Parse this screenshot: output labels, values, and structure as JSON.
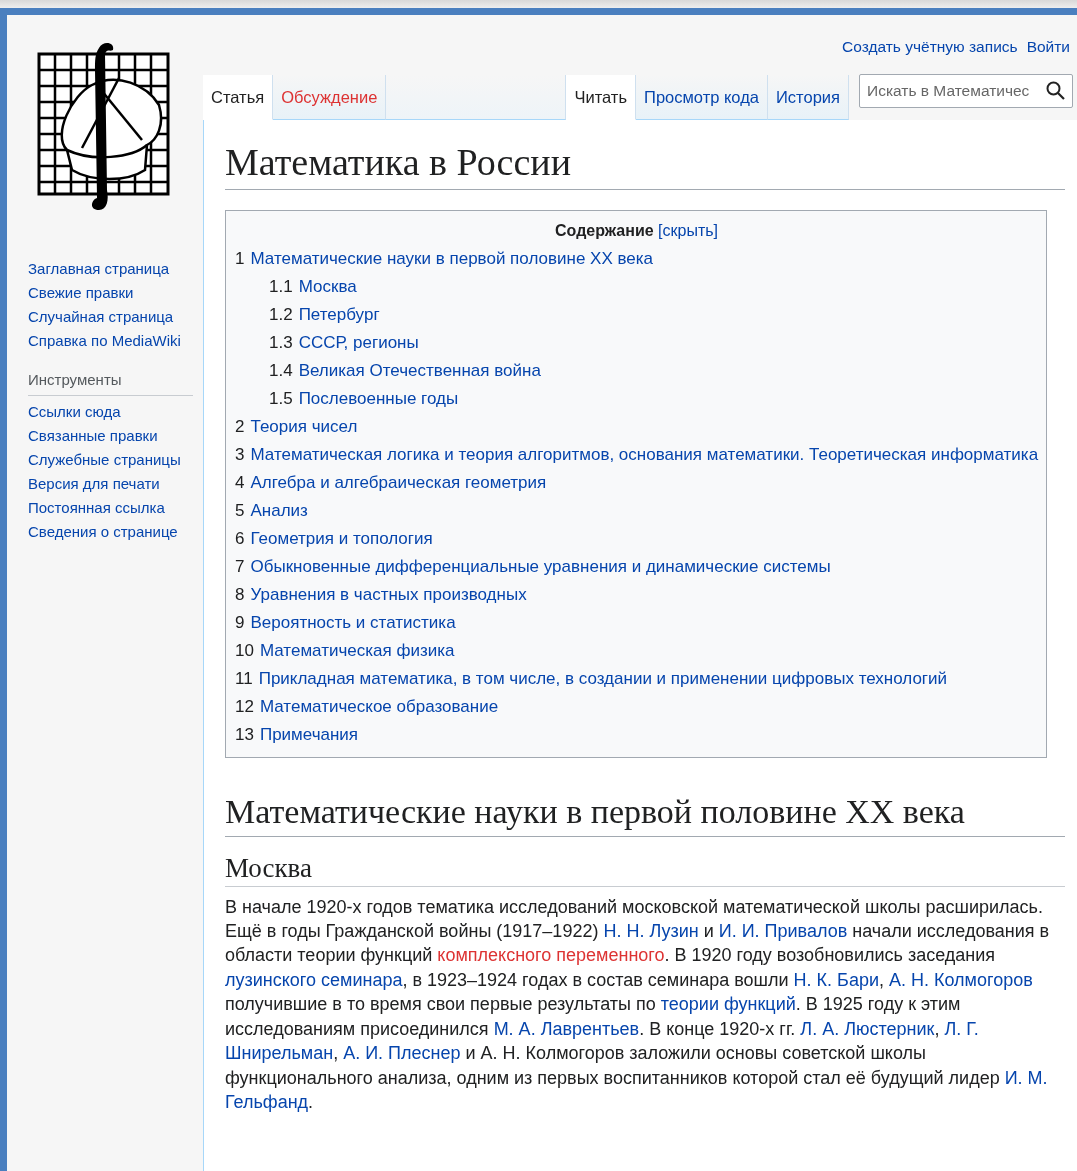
{
  "personal_links": [
    "Создать учётную запись",
    "Войти"
  ],
  "sidebar": {
    "navigation": [
      "Заглавная страница",
      "Свежие правки",
      "Случайная страница",
      "Справка по MediaWiki"
    ],
    "tools_heading": "Инструменты",
    "tools": [
      "Ссылки сюда",
      "Связанные правки",
      "Служебные страницы",
      "Версия для печати",
      "Постоянная ссылка",
      "Сведения о странице"
    ]
  },
  "tabs_left": [
    {
      "label": "Статья",
      "selected": true,
      "exists": true
    },
    {
      "label": "Обсуждение",
      "selected": false,
      "exists": false
    }
  ],
  "tabs_right": [
    {
      "label": "Читать",
      "selected": true
    },
    {
      "label": "Просмотр кода",
      "selected": false
    },
    {
      "label": "История",
      "selected": false
    }
  ],
  "search": {
    "placeholder": "Искать в Математичес"
  },
  "title": "Математика в России",
  "toc": {
    "title": "Содержание",
    "toggle": "[скрыть]",
    "items": [
      {
        "number": "1",
        "text": "Математические науки в первой половине XX века",
        "children": [
          {
            "number": "1.1",
            "text": "Москва"
          },
          {
            "number": "1.2",
            "text": "Петербург"
          },
          {
            "number": "1.3",
            "text": "СССР, регионы"
          },
          {
            "number": "1.4",
            "text": "Великая Отечественная война"
          },
          {
            "number": "1.5",
            "text": "Послевоенные годы"
          }
        ]
      },
      {
        "number": "2",
        "text": "Теория чисел"
      },
      {
        "number": "3",
        "text": "Математическая логика и теория алгоритмов, основания математики. Теоретическая информатика"
      },
      {
        "number": "4",
        "text": "Алгебра и алгебраическая геометрия"
      },
      {
        "number": "5",
        "text": "Анализ"
      },
      {
        "number": "6",
        "text": "Геометрия и топология"
      },
      {
        "number": "7",
        "text": "Обыкновенные дифференциальные уравнения и динамические системы"
      },
      {
        "number": "8",
        "text": "Уравнения в частных производных"
      },
      {
        "number": "9",
        "text": "Вероятность и статистика"
      },
      {
        "number": "10",
        "text": "Математическая физика"
      },
      {
        "number": "11",
        "text": "Прикладная математика, в том числе, в создании и применении цифровых технологий"
      },
      {
        "number": "12",
        "text": "Математическое образование"
      },
      {
        "number": "13",
        "text": "Примечания"
      }
    ]
  },
  "sections": [
    {
      "kind": "h2",
      "heading": "Математические науки в первой половине XX века"
    },
    {
      "kind": "h3",
      "heading": "Москва",
      "paragraph": [
        {
          "kind": "text",
          "text": "В начале 1920-х годов тематика исследований московской математической школы расширилась. Ещё в годы Гражданской войны (1917–1922) "
        },
        {
          "kind": "link",
          "text": "Н. Н. Лузин"
        },
        {
          "kind": "text",
          "text": " и "
        },
        {
          "kind": "link",
          "text": "И. И. Привалов"
        },
        {
          "kind": "text",
          "text": " начали исследования в области теории функций "
        },
        {
          "kind": "new_link",
          "text": "комплексного переменного"
        },
        {
          "kind": "text",
          "text": ". В 1920 году возобновились заседания "
        },
        {
          "kind": "link",
          "text": "лузинского семинара"
        },
        {
          "kind": "text",
          "text": ", в 1923–1924 годах в состав семинара вошли "
        },
        {
          "kind": "link",
          "text": "Н. К. Бари"
        },
        {
          "kind": "text",
          "text": ", "
        },
        {
          "kind": "link",
          "text": "А. Н. Колмогоров"
        },
        {
          "kind": "text",
          "text": " получившие в то время свои первые результаты по "
        },
        {
          "kind": "link",
          "text": "теории функций"
        },
        {
          "kind": "text",
          "text": ". В 1925 году к этим исследованиям присоединился "
        },
        {
          "kind": "link",
          "text": "М. А. Лаврентьев"
        },
        {
          "kind": "text",
          "text": ". В конце 1920-х гг. "
        },
        {
          "kind": "link",
          "text": "Л. А. Люстерник"
        },
        {
          "kind": "text",
          "text": ", "
        },
        {
          "kind": "link",
          "text": "Л. Г.",
          "space_after": true
        },
        {
          "kind": "link",
          "text": "Шнирельман"
        },
        {
          "kind": "text",
          "text": ", "
        },
        {
          "kind": "link",
          "text": "А. И. Плеснер"
        },
        {
          "kind": "text",
          "text": " и А. Н. Колмогоров заложили основы советской школы функционального анализа, одним из первых воспитанников которой стал её будущий лидер "
        },
        {
          "kind": "link",
          "text": "И. М.",
          "space_after": true
        },
        {
          "kind": "link",
          "text": "Гельфанд"
        },
        {
          "kind": "text",
          "text": "."
        }
      ]
    }
  ]
}
